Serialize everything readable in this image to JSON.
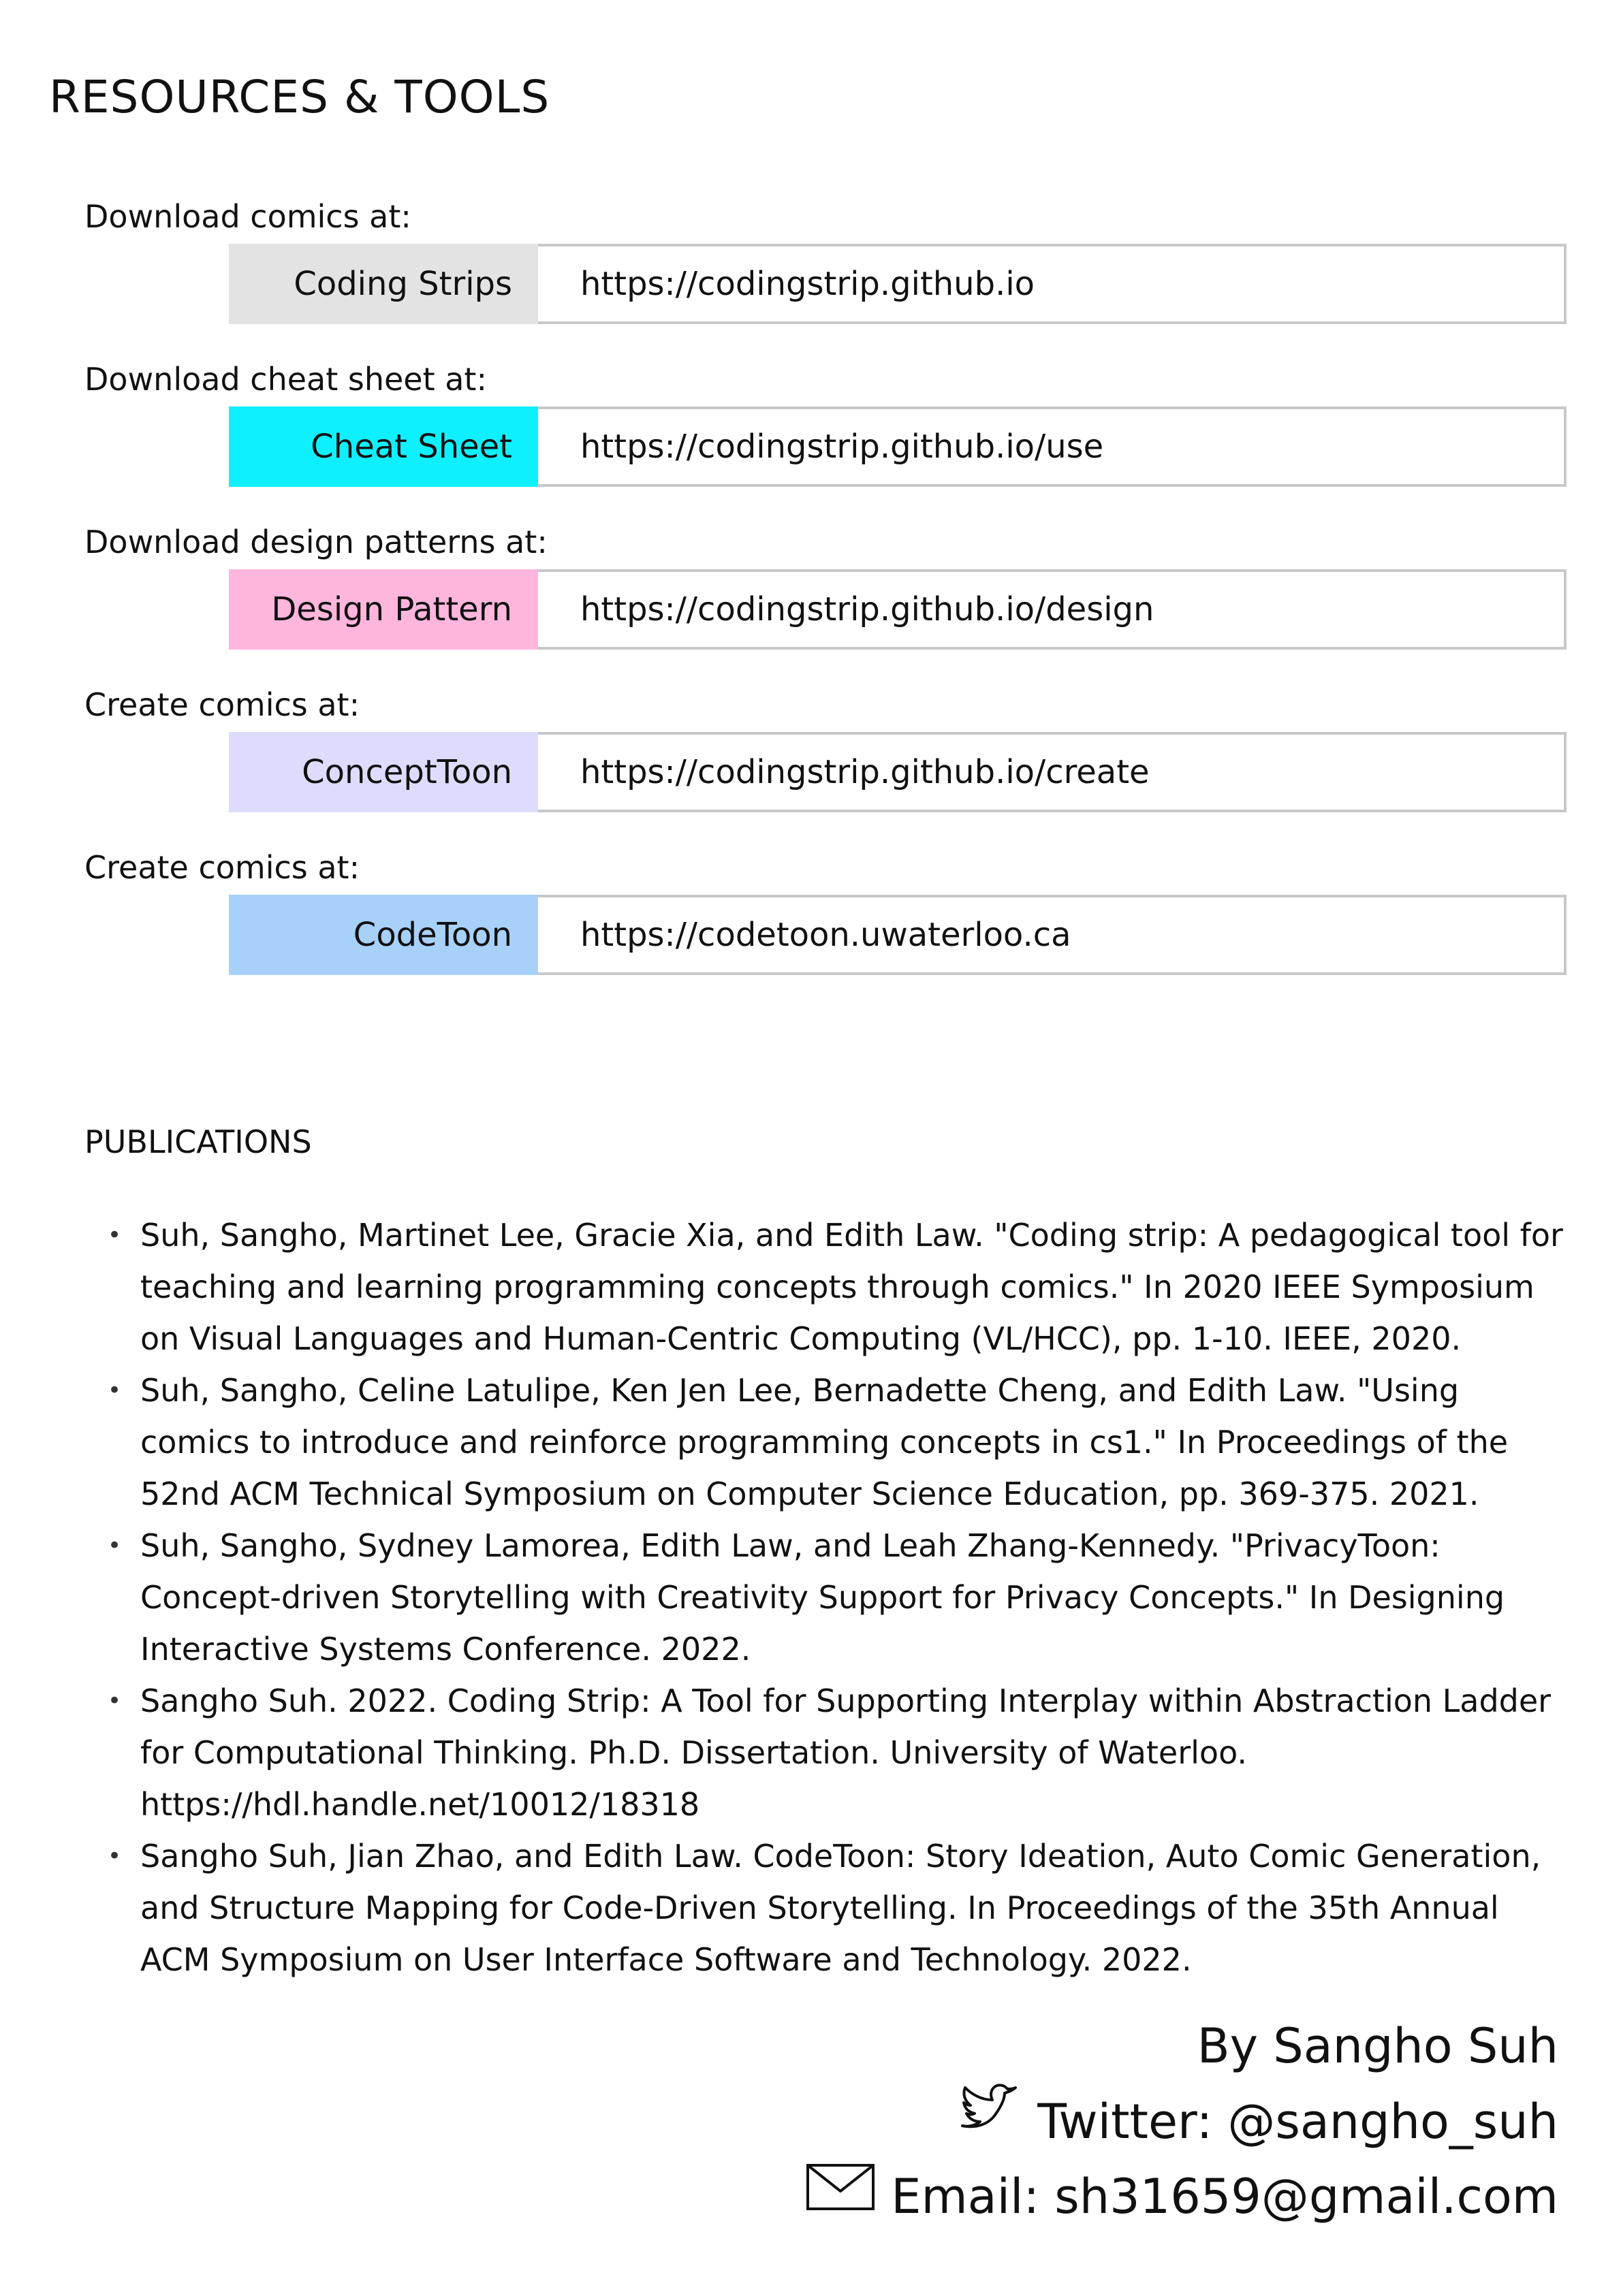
{
  "page_title": "RESOURCES & TOOLS",
  "resources": [
    {
      "caption": "Download comics at:",
      "label": "Coding Strips",
      "url": "https://codingstrip.github.io",
      "color": "#e3e3e3"
    },
    {
      "caption": "Download cheat sheet at:",
      "label": "Cheat Sheet",
      "url": "https://codingstrip.github.io/use",
      "color": "#0ff0ff"
    },
    {
      "caption": "Download design patterns at:",
      "label": "Design Pattern",
      "url": "https://codingstrip.github.io/design",
      "color": "#ffb6dc"
    },
    {
      "caption": "Create comics at:",
      "label": "ConceptToon",
      "url": "https://codingstrip.github.io/create",
      "color": "#dedcfd"
    },
    {
      "caption": "Create comics at:",
      "label": "CodeToon",
      "url": "https://codetoon.uwaterloo.ca",
      "color": "#a8d1fa"
    }
  ],
  "publications_heading": "PUBLICATIONS",
  "publications": [
    "Suh, Sangho, Martinet Lee, Gracie Xia, and Edith Law. \"Coding strip: A pedagogical tool for teaching and learning programming concepts through comics.\" In 2020 IEEE Symposium on Visual Languages and Human-Centric Computing (VL/HCC), pp. 1-10. IEEE, 2020.",
    "Suh, Sangho, Celine Latulipe, Ken Jen Lee, Bernadette Cheng, and Edith Law. \"Using comics to introduce and reinforce programming concepts in cs1.\" In Proceedings of the 52nd ACM Technical Symposium on Computer Science Education, pp. 369-375. 2021.",
    "Suh, Sangho, Sydney Lamorea, Edith Law, and Leah Zhang-Kennedy. \"PrivacyToon: Concept-driven Storytelling with Creativity Support for Privacy Concepts.\" In Designing Interactive Systems Conference. 2022.",
    "Sangho Suh. 2022. Coding Strip: A Tool for Supporting Interplay within Abstraction Ladder for Computational Thinking. Ph.D. Dissertation. University of Waterloo. https://hdl.handle.net/10012/18318",
    "Sangho Suh, Jian Zhao, and Edith Law. CodeToon: Story Ideation, Auto Comic Generation, and Structure Mapping for Code-Driven Storytelling. In Proceedings of the 35th Annual ACM Symposium on User Interface Software and Technology. 2022."
  ],
  "signature": {
    "byline": "By Sangho Suh",
    "twitter": "Twitter: @sangho_suh",
    "email": "Email: sh31659@gmail.com",
    "twitter_icon": "bird-icon",
    "email_icon": "envelope-icon"
  }
}
